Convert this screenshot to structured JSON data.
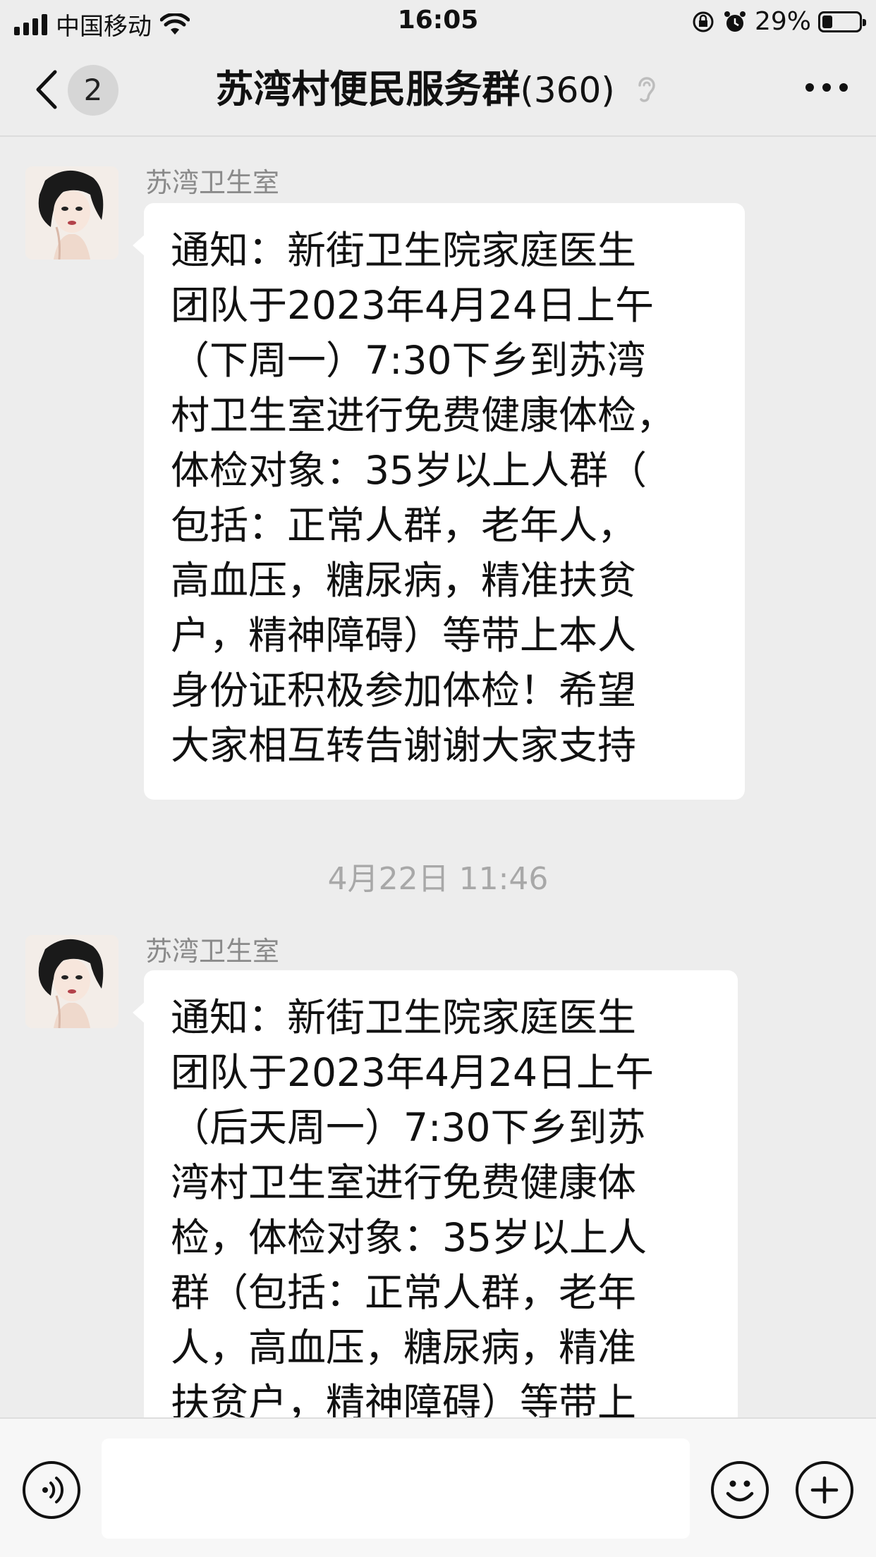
{
  "status_bar": {
    "carrier": "中国移动",
    "time": "16:05",
    "battery_percent": "29%",
    "battery_level": 0.29,
    "icons": [
      "signal-icon",
      "wifi-icon",
      "rotation-lock-icon",
      "alarm-icon",
      "battery-icon"
    ]
  },
  "nav": {
    "unread_count": "2",
    "title": "苏湾村便民服务群",
    "member_count": "(360)",
    "icons": [
      "back-chevron-icon",
      "mute-ear-icon",
      "more-dots-icon"
    ]
  },
  "messages": [
    {
      "sender": "苏湾卫生室",
      "text": "通知：新街卫生院家庭医生\n团队于2023年4月24日上午\n（下周一）7:30下乡到苏湾\n村卫生室进行免费健康体检，\n体检对象：35岁以上人群（\n包括：正常人群，老年人，\n高血压，糖尿病，精准扶贫\n户，精神障碍）等带上本人\n身份证积极参加体检！希望\n大家相互转告谢谢大家支持"
    },
    {
      "sender": "苏湾卫生室",
      "text": "通知：新街卫生院家庭医生\n团队于2023年4月24日上午\n（后天周一）7:30下乡到苏\n湾村卫生室进行免费健康体\n检，体检对象：35岁以上人\n群（包括：正常人群，老年\n人，高血压，糖尿病，精准\n扶贫户，精神障碍）等带上"
    }
  ],
  "timestamp": "4月22日 11:46",
  "input_bar": {
    "icons": [
      "voice-input-icon",
      "emoji-icon",
      "add-plus-icon"
    ],
    "text_value": ""
  },
  "colors": {
    "background": "#ededed",
    "bubble": "#ffffff",
    "sender_text": "#8a8a8a",
    "timestamp_text": "#a8a8a8"
  }
}
